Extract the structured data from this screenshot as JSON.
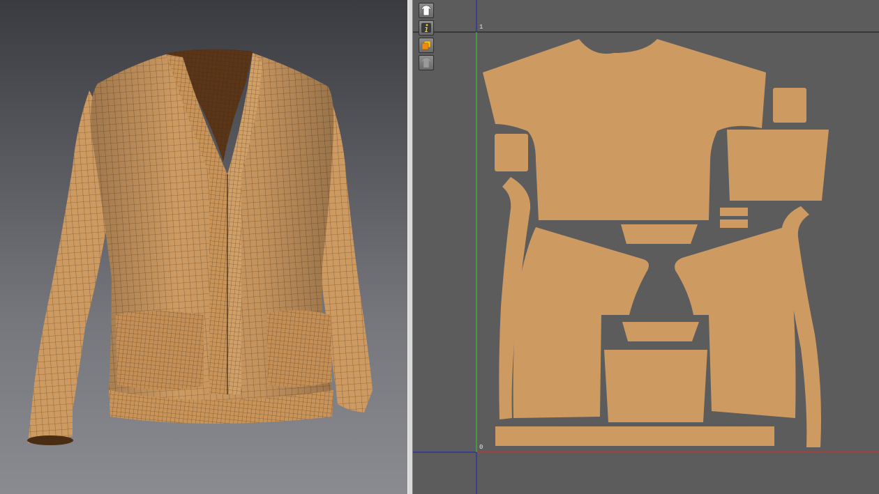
{
  "uv_editor": {
    "axis_labels": {
      "top": "1",
      "bottom": "0"
    },
    "tools": [
      {
        "icon": "garment-view-icon"
      },
      {
        "icon": "info-icon"
      },
      {
        "icon": "fabric-color-icon"
      },
      {
        "icon": "garment-disabled-icon"
      }
    ]
  },
  "colors": {
    "fabric": "#cd9a62",
    "mesh_line": "#3a2410",
    "uv_background": "#5c5c5c",
    "axis_x": "#c83232",
    "axis_y": "#3cbe3c",
    "axis_v": "#2a2aa8",
    "splitter": "#d9d9d9"
  }
}
